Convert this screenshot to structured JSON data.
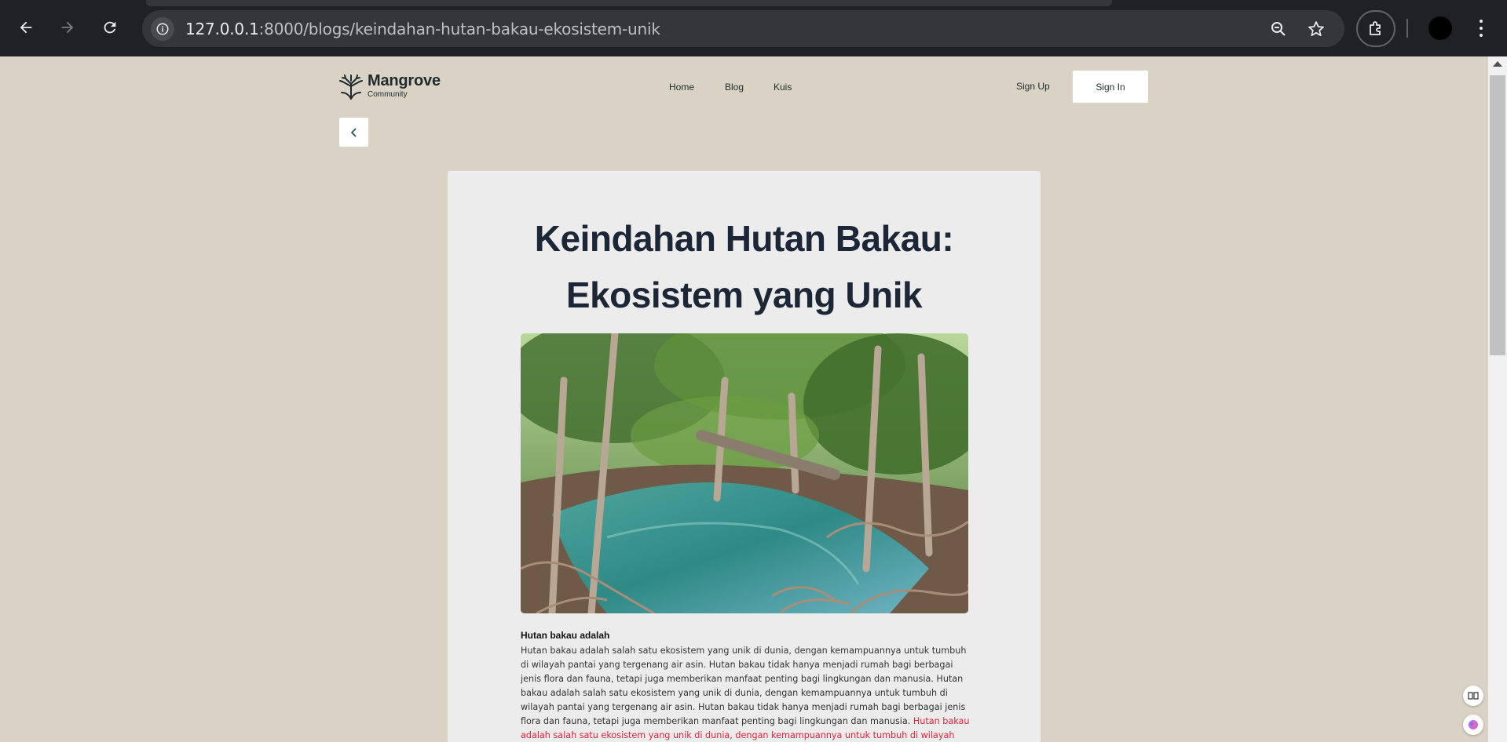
{
  "browser": {
    "url_host": "127.0.0.1",
    "url_rest": ":8000/blogs/keindahan-hutan-bakau-ekosistem-unik",
    "back_icon": "arrow-left-icon",
    "forward_icon": "arrow-right-icon",
    "reload_icon": "reload-icon",
    "info_icon": "info-icon",
    "zoom_icon": "zoom-icon",
    "bookmark_icon": "star-icon",
    "extensions_icon": "puzzle-icon",
    "menu_icon": "more-vert-icon"
  },
  "site": {
    "logo_name": "Mangrove",
    "logo_sub": "Community",
    "nav": [
      "Home",
      "Blog",
      "Kuis"
    ],
    "signup_label": "Sign Up",
    "signin_label": "Sign In",
    "back_icon": "chevron-left-icon"
  },
  "article": {
    "title_line1": "Keindahan Hutan Bakau:",
    "title_line2": "Ekosistem yang Unik",
    "image_alt": "mangrove forest",
    "subhead": "Hutan bakau adalah",
    "body_black": "Hutan bakau adalah salah satu ekosistem yang unik di dunia, dengan kemampuannya untuk tumbuh di wilayah pantai yang tergenang air asin. Hutan bakau tidak hanya menjadi rumah bagi berbagai jenis flora dan fauna, tetapi juga memberikan manfaat penting bagi lingkungan dan manusia. Hutan bakau adalah salah satu ekosistem yang unik di dunia, dengan kemampuannya untuk tumbuh di wilayah pantai yang tergenang air asin. Hutan bakau tidak hanya menjadi rumah bagi berbagai jenis flora dan fauna, tetapi juga memberikan manfaat penting bagi lingkungan dan manusia. ",
    "body_red": "Hutan bakau adalah salah satu ekosistem yang unik di dunia, dengan kemampuannya untuk tumbuh di wilayah pantai yang tergenang air asin. Hutan"
  },
  "colors": {
    "page_bg": "#d9d2c5",
    "card_bg": "#ececec",
    "title": "#1b2637",
    "highlight": "#e3213a"
  }
}
